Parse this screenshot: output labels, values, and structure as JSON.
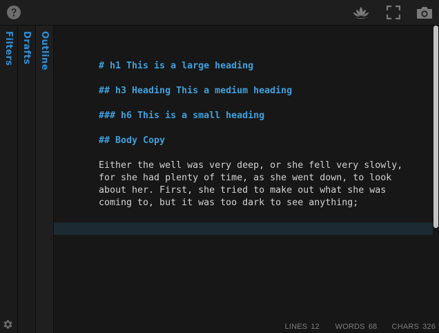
{
  "toolbar": {
    "help_icon": "question-circle-icon",
    "focus_icon": "lotus-icon",
    "fullscreen_icon": "fullscreen-icon",
    "screenshot_icon": "camera-icon"
  },
  "sidebar": {
    "tabs": [
      {
        "label": "Filters"
      },
      {
        "label": "Drafts"
      },
      {
        "label": "Outline"
      }
    ],
    "settings_icon": "gear-icon"
  },
  "editor": {
    "lines": [
      "# h1 This is a large heading",
      "## h3 Heading This a medium heading",
      "### h6 This is a small heading",
      "## Body Copy"
    ],
    "body": "Either the well was very deep, or she fell very slowly,\nfor she had plenty of time, as she went down, to look\nabout her. First, she tried to make out what she was\ncoming to, but it was too dark to see anything;",
    "scroll_position": 0.0
  },
  "status": {
    "lines_label": "LINES",
    "lines_value": "12",
    "words_label": "WORDS",
    "words_value": "68",
    "chars_label": "CHARS",
    "chars_value": "326"
  },
  "colors": {
    "accent": "#3fa0dc",
    "background": "#171717",
    "toolbar": "#1e1e1e",
    "text": "#d2d2d2",
    "current_line": "#1b2a33"
  }
}
